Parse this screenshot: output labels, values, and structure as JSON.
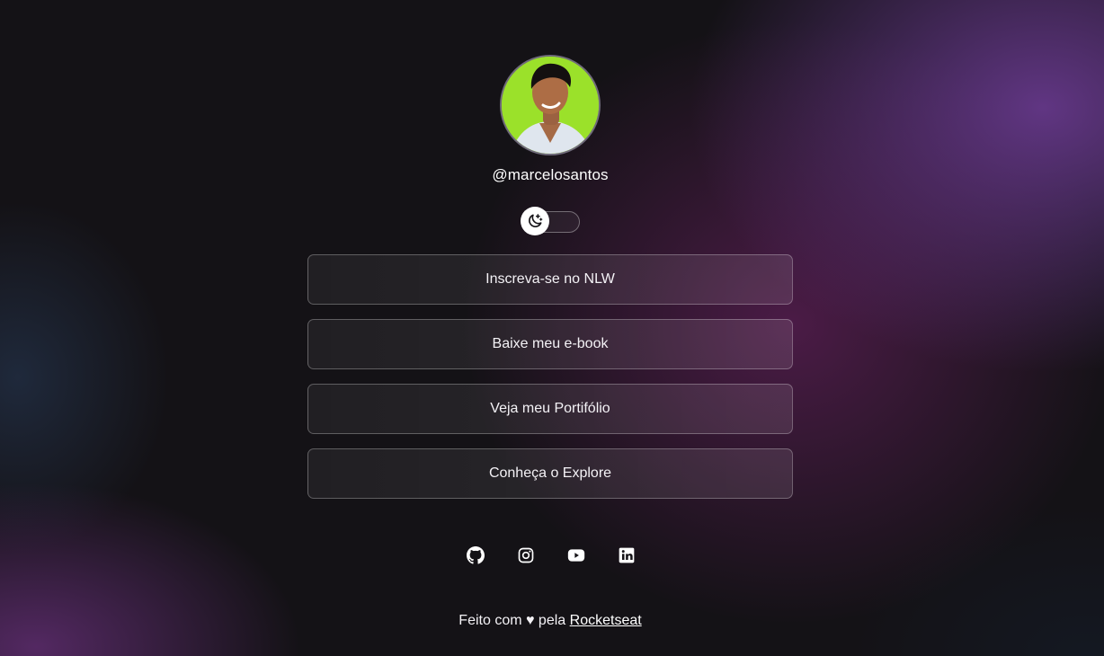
{
  "profile": {
    "username": "@marcelosantos",
    "avatar_bg": "#9be12a"
  },
  "theme_switch": {
    "icon": "moon-stars-icon",
    "state": "dark"
  },
  "links": [
    {
      "label": "Inscreva-se no NLW"
    },
    {
      "label": "Baixe meu e-book"
    },
    {
      "label": "Veja meu Portifólio"
    },
    {
      "label": "Conheça o Explore"
    }
  ],
  "social": [
    {
      "icon": "github-icon"
    },
    {
      "icon": "instagram-icon"
    },
    {
      "icon": "youtube-icon"
    },
    {
      "icon": "linkedin-icon"
    }
  ],
  "footer": {
    "prefix": "Feito com ♥ pela",
    "link_label": "Rocketseat"
  }
}
